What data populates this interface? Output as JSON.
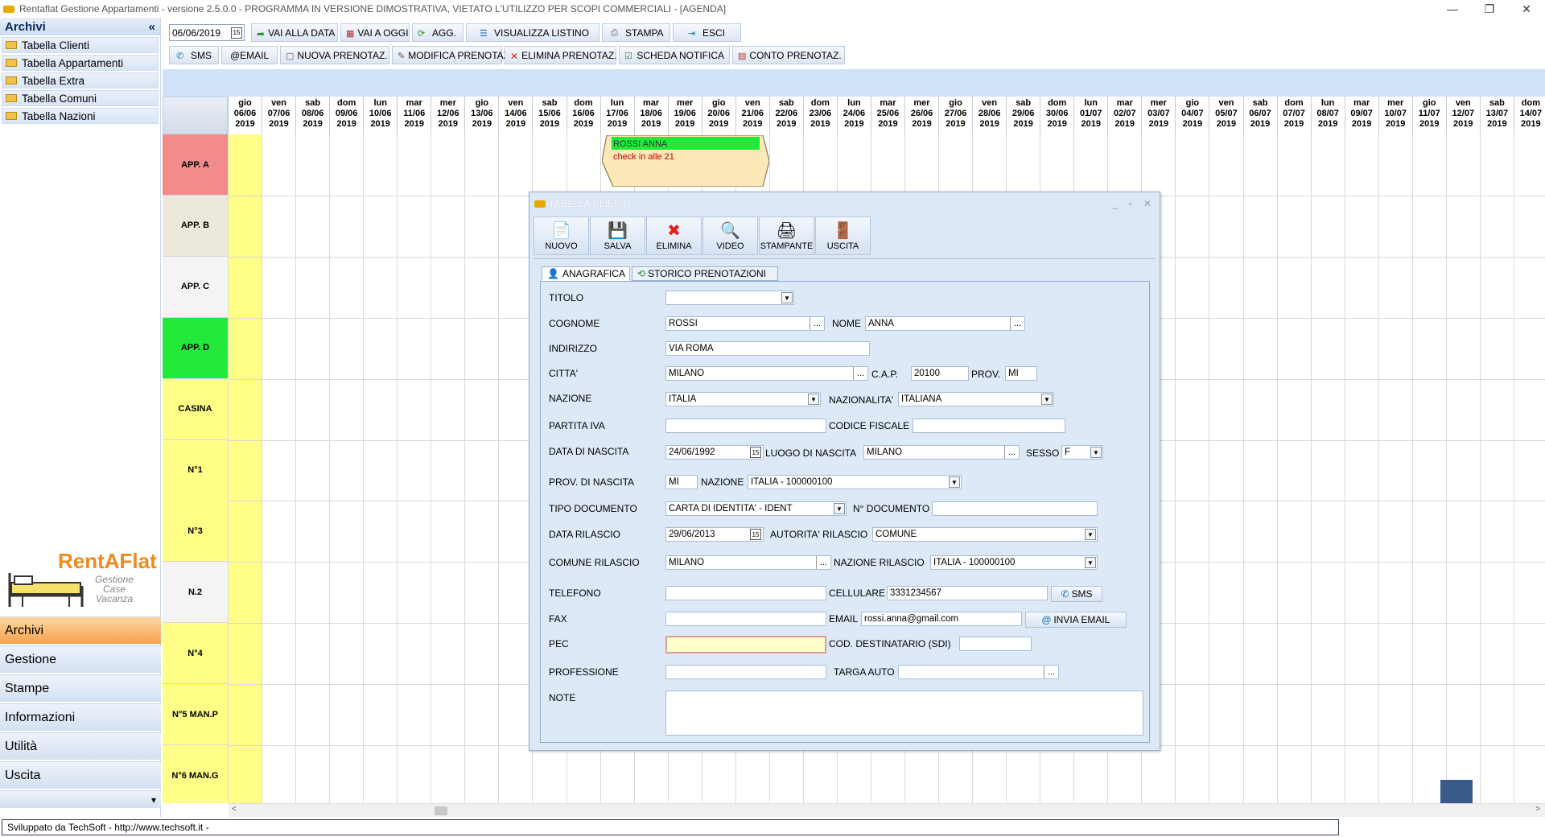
{
  "window": {
    "title": "Rentaflat Gestione Appartamenti - versione 2.5.0.0 - PROGRAMMA IN VERSIONE DIMOSTRATIVA, VIETATO L'UTILIZZO PER SCOPI COMMERCIALI - [AGENDA]",
    "minimize": "—",
    "restore": "❐",
    "close": "✕"
  },
  "sidebar": {
    "header": "Archivi",
    "collapse": "«",
    "items": [
      {
        "label": "Tabella Clienti"
      },
      {
        "label": "Tabella Appartamenti"
      },
      {
        "label": "Tabella Extra"
      },
      {
        "label": "Tabella Comuni"
      },
      {
        "label": "Tabella Nazioni"
      }
    ],
    "logo": {
      "brand": "RentAFlat",
      "tagline_1": "Gestione",
      "tagline_2": "Case",
      "tagline_3": "Vacanza"
    },
    "nav": [
      {
        "label": "Archivi",
        "active": true
      },
      {
        "label": "Gestione"
      },
      {
        "label": "Stampe"
      },
      {
        "label": "Informazioni"
      },
      {
        "label": "Utilità"
      },
      {
        "label": "Uscita"
      }
    ],
    "scroll_down": "▾"
  },
  "toolbar": {
    "date": "06/06/2019",
    "row1": [
      "VAI ALLA DATA",
      "VAI A OGGI",
      "AGG.",
      "VISUALIZZA LISTINO",
      "STAMPA",
      "ESCI"
    ],
    "row2": [
      "SMS",
      "@EMAIL",
      "NUOVA PRENOTAZ.",
      "MODIFICA PRENOTAZ.",
      "ELIMINA PRENOTAZ.",
      "SCHEDA NOTIFICA",
      "CONTO PRENOTAZ."
    ]
  },
  "agenda": {
    "days": [
      [
        "gio",
        "06/06",
        "2019"
      ],
      [
        "ven",
        "07/06",
        "2019"
      ],
      [
        "sab",
        "08/06",
        "2019"
      ],
      [
        "dom",
        "09/06",
        "2019"
      ],
      [
        "lun",
        "10/06",
        "2019"
      ],
      [
        "mar",
        "11/06",
        "2019"
      ],
      [
        "mer",
        "12/06",
        "2019"
      ],
      [
        "gio",
        "13/06",
        "2019"
      ],
      [
        "ven",
        "14/06",
        "2019"
      ],
      [
        "sab",
        "15/06",
        "2019"
      ],
      [
        "dom",
        "16/06",
        "2019"
      ],
      [
        "lun",
        "17/06",
        "2019"
      ],
      [
        "mar",
        "18/06",
        "2019"
      ],
      [
        "mer",
        "19/06",
        "2019"
      ],
      [
        "gio",
        "20/06",
        "2019"
      ],
      [
        "ven",
        "21/06",
        "2019"
      ],
      [
        "sab",
        "22/06",
        "2019"
      ],
      [
        "dom",
        "23/06",
        "2019"
      ],
      [
        "lun",
        "24/06",
        "2019"
      ],
      [
        "mar",
        "25/06",
        "2019"
      ],
      [
        "mer",
        "26/06",
        "2019"
      ],
      [
        "gio",
        "27/06",
        "2019"
      ],
      [
        "ven",
        "28/06",
        "2019"
      ],
      [
        "sab",
        "29/06",
        "2019"
      ],
      [
        "dom",
        "30/06",
        "2019"
      ],
      [
        "lun",
        "01/07",
        "2019"
      ],
      [
        "mar",
        "02/07",
        "2019"
      ],
      [
        "mer",
        "03/07",
        "2019"
      ],
      [
        "gio",
        "04/07",
        "2019"
      ],
      [
        "ven",
        "05/07",
        "2019"
      ],
      [
        "sab",
        "06/07",
        "2019"
      ],
      [
        "dom",
        "07/07",
        "2019"
      ],
      [
        "lun",
        "08/07",
        "2019"
      ],
      [
        "mar",
        "09/07",
        "2019"
      ],
      [
        "mer",
        "10/07",
        "2019"
      ],
      [
        "gio",
        "11/07",
        "2019"
      ],
      [
        "ven",
        "12/07",
        "2019"
      ],
      [
        "sab",
        "13/07",
        "2019"
      ],
      [
        "dom",
        "14/07",
        "2019"
      ]
    ],
    "rooms": [
      {
        "label": "APP. A",
        "color": "#f28c8c"
      },
      {
        "label": "APP. B",
        "color": "#ece9dc"
      },
      {
        "label": "APP. C",
        "color": "#f4f4f4"
      },
      {
        "label": "APP. D",
        "color": "#22e83a"
      },
      {
        "label": "CASINA",
        "color": "#ffff88"
      },
      {
        "label": "N°1",
        "color": "#ffff88"
      },
      {
        "label": "N°3",
        "color": "#ffff88"
      },
      {
        "label": "N.2",
        "color": "#f4f4f4"
      },
      {
        "label": "N°4",
        "color": "#ffff88"
      },
      {
        "label": "N°5 MAN.P",
        "color": "#ffff88"
      },
      {
        "label": "N°6 MAN.G",
        "color": "#ffff88"
      }
    ],
    "booking": {
      "guest": "ROSSI ANNA",
      "note": "check in alle 21"
    },
    "scroll_left": "<",
    "scroll_right": ">"
  },
  "status": {
    "text": "Sviluppato da TechSoft - http://www.techsoft.it -"
  },
  "dialog": {
    "title": "TABELLA CLIENTI",
    "tools": [
      {
        "label": "NUOVO",
        "icon": "📄"
      },
      {
        "label": "SALVA",
        "icon": "💾"
      },
      {
        "label": "ELIMINA",
        "icon": "✖"
      },
      {
        "label": "VIDEO",
        "icon": "🔍"
      },
      {
        "label": "STAMPANTE",
        "icon": "🖨"
      },
      {
        "label": "USCITA",
        "icon": "🚪"
      }
    ],
    "tabs": [
      "ANAGRAFICA",
      "STORICO PRENOTAZIONI"
    ],
    "labels": {
      "titolo": "TITOLO",
      "cognome": "COGNOME",
      "nome": "NOME",
      "indirizzo": "INDIRIZZO",
      "citta": "CITTA'",
      "cap": "C.A.P.",
      "prov": "PROV.",
      "nazione": "NAZIONE",
      "nazionalita": "NAZIONALITA'",
      "piva": "PARTITA IVA",
      "cf": "CODICE FISCALE",
      "data_nascita": "DATA DI NASCITA",
      "luogo_nascita": "LUOGO DI NASCITA",
      "sesso": "SESSO",
      "prov_nascita": "PROV. DI NASCITA",
      "nazione2": "NAZIONE",
      "tipo_doc": "TIPO DOCUMENTO",
      "num_doc": "N° DOCUMENTO",
      "data_rilascio": "DATA RILASCIO",
      "autorita": "AUTORITA' RILASCIO",
      "comune_rilascio": "COMUNE RILASCIO",
      "nazione_rilascio": "NAZIONE RILASCIO",
      "telefono": "TELEFONO",
      "cellulare": "CELLULARE",
      "fax": "FAX",
      "email": "EMAIL",
      "pec": "PEC",
      "sdi": "COD. DESTINATARIO (SDI)",
      "professione": "PROFESSIONE",
      "targa": "TARGA AUTO",
      "note": "NOTE"
    },
    "values": {
      "titolo": "",
      "cognome": "ROSSI",
      "nome": "ANNA",
      "indirizzo": "VIA ROMA",
      "citta": "MILANO",
      "cap": "20100",
      "prov": "MI",
      "nazione": "ITALIA",
      "nazionalita": "ITALIANA",
      "piva": "",
      "cf": "",
      "data_nascita": "24/06/1992",
      "luogo_nascita": "MILANO",
      "sesso": "F",
      "prov_nascita": "MI",
      "nazione2": "ITALIA - 100000100",
      "tipo_doc": "CARTA DI IDENTITA' - IDENT",
      "num_doc": "",
      "data_rilascio": "29/06/2013",
      "autorita": "COMUNE",
      "comune_rilascio": "MILANO",
      "nazione_rilascio": "ITALIA - 100000100",
      "telefono": "",
      "cellulare": "3331234567",
      "fax": "",
      "email": "rossi.anna@gmail.com",
      "pec": "",
      "sdi": "",
      "professione": "",
      "targa": "",
      "note": ""
    },
    "buttons": {
      "sms": "SMS",
      "invia_email": "INVIA EMAIL"
    }
  }
}
